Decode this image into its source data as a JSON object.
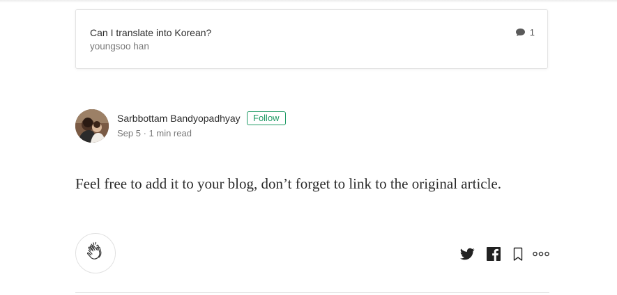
{
  "response_card": {
    "title": "Can I translate into Korean?",
    "author": "youngsoo han",
    "response_count": "1",
    "icon": "speech-bubble-icon"
  },
  "author": {
    "name": "Sarbbottam Bandyopadhyay",
    "follow_label": "Follow",
    "meta": "Sep 5 · 1 min read",
    "avatar": "author-avatar"
  },
  "post": {
    "body": "Feel free to add it to your blog, don’t forget to link to the original article."
  },
  "actions": {
    "clap_icon": "clap-icon",
    "twitter_icon": "twitter-icon",
    "facebook_icon": "facebook-icon",
    "bookmark_icon": "bookmark-icon",
    "more_icon": "more-icon"
  },
  "colors": {
    "accent_green": "#1c9963",
    "text": "#222222",
    "muted": "#757575",
    "border": "#e3e3e3"
  }
}
